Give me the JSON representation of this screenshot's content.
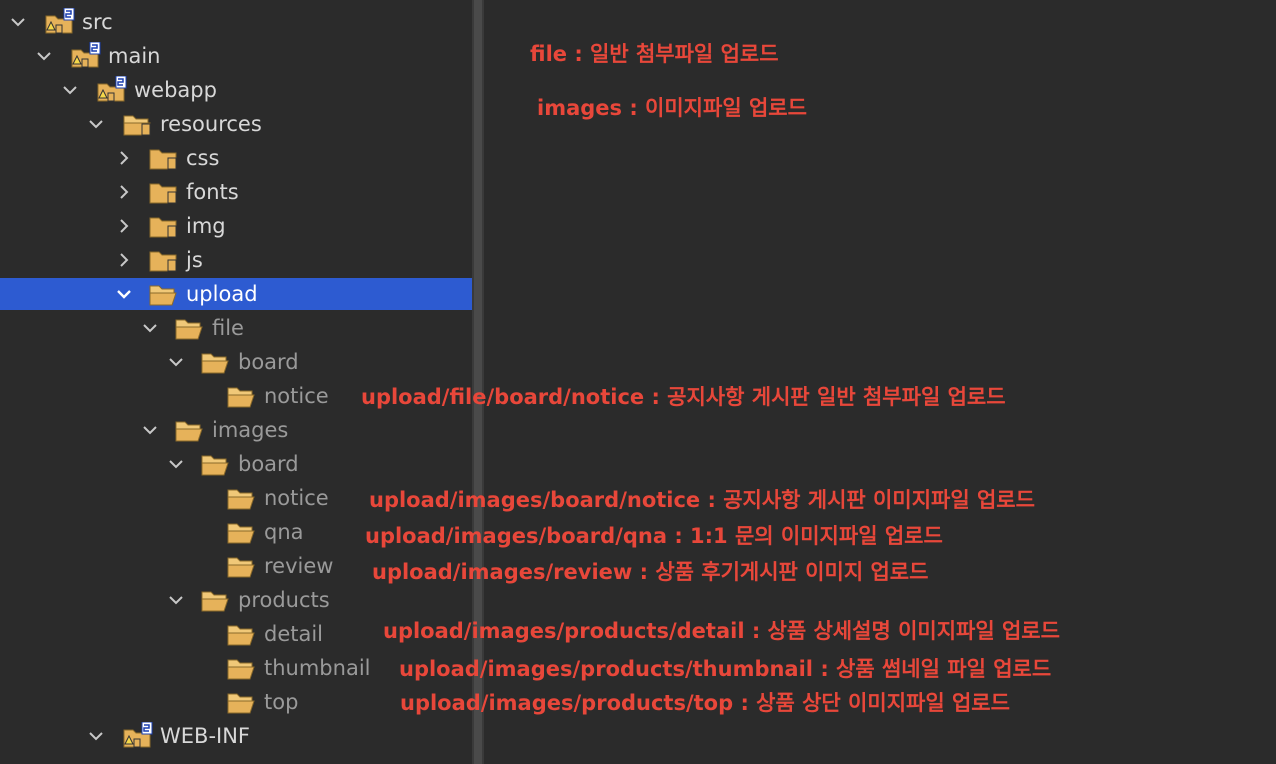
{
  "tree": [
    {
      "label": "src",
      "expanded": true,
      "icon": "source-folder-icon"
    },
    {
      "label": "main",
      "expanded": true,
      "icon": "source-folder-icon"
    },
    {
      "label": "webapp",
      "expanded": true,
      "icon": "source-folder-icon"
    },
    {
      "label": "resources",
      "expanded": true,
      "icon": "folder-open-icon"
    },
    {
      "label": "css",
      "expanded": false,
      "icon": "folder-icon"
    },
    {
      "label": "fonts",
      "expanded": false,
      "icon": "folder-icon"
    },
    {
      "label": "img",
      "expanded": false,
      "icon": "folder-icon"
    },
    {
      "label": "js",
      "expanded": false,
      "icon": "folder-icon"
    },
    {
      "label": "upload",
      "expanded": true,
      "icon": "folder-open-icon",
      "selected": true
    },
    {
      "label": "file",
      "expanded": true,
      "icon": "folder-open-icon"
    },
    {
      "label": "board",
      "expanded": true,
      "icon": "folder-open-icon"
    },
    {
      "label": "notice",
      "icon": "folder-open-icon"
    },
    {
      "label": "images",
      "expanded": true,
      "icon": "folder-open-icon"
    },
    {
      "label": "board",
      "expanded": true,
      "icon": "folder-open-icon"
    },
    {
      "label": "notice",
      "icon": "folder-open-icon"
    },
    {
      "label": "qna",
      "icon": "folder-open-icon"
    },
    {
      "label": "review",
      "icon": "folder-open-icon"
    },
    {
      "label": "products",
      "expanded": true,
      "icon": "folder-open-icon"
    },
    {
      "label": "detail",
      "icon": "folder-open-icon"
    },
    {
      "label": "thumbnail",
      "icon": "folder-open-icon"
    },
    {
      "label": "top",
      "icon": "folder-open-icon"
    },
    {
      "label": "WEB-INF",
      "expanded": true,
      "icon": "source-folder-icon"
    }
  ],
  "annotations": [
    "file : 일반 첨부파일 업로드",
    "images : 이미지파일 업로드",
    "upload/file/board/notice : 공지사항 게시판 일반 첨부파일 업로드",
    "upload/images/board/notice : 공지사항 게시판 이미지파일 업로드",
    "upload/images/board/qna : 1:1 문의 이미지파일 업로드",
    "upload/images/review : 상품 후기게시판 이미지 업로드",
    "upload/images/products/detail : 상품 상세설명 이미지파일 업로드",
    "upload/images/products/thumbnail : 상품 썸네일 파일 업로드",
    "upload/images/products/top : 상품 상단 이미지파일 업로드"
  ],
  "colors": {
    "background": "#2b2b2b",
    "selection": "#2d5bd1",
    "annotation": "#e8473a",
    "folder": "#e6b25a"
  }
}
